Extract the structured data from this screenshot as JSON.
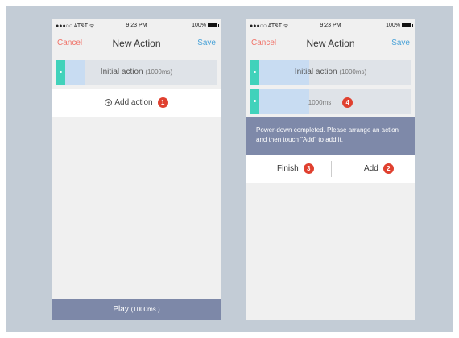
{
  "left_screen": {
    "status": {
      "carrier": "●●●○○ AT&T ᯤ",
      "time": "9:23 PM",
      "battery": "100%"
    },
    "nav": {
      "cancel": "Cancel",
      "title": "New Action",
      "save": "Save"
    },
    "rows": [
      {
        "label": "Initial action",
        "duration": "(1000ms)"
      }
    ],
    "add_action": {
      "label": "Add action",
      "badge": "1"
    },
    "play": {
      "label": "Play",
      "duration": "(1000ms )"
    }
  },
  "right_screen": {
    "status": {
      "carrier": "●●●○○ AT&T ᯤ",
      "time": "9:23 PM",
      "battery": "100%"
    },
    "nav": {
      "cancel": "Cancel",
      "title": "New Action",
      "save": "Save"
    },
    "rows": [
      {
        "label": "Initial action",
        "duration": "(1000ms)"
      },
      {
        "label": "1000ms",
        "badge": "4"
      }
    ],
    "toast": "Power-down completed. Please arrange an action and then touch \"Add\" to add it.",
    "finish": {
      "label": "Finish",
      "badge": "3"
    },
    "add": {
      "label": "Add",
      "badge": "2"
    }
  },
  "colors": {
    "backdrop": "#c3ccd6",
    "accent_teal": "#41d2bb",
    "bar_fill": "#c8dcf2",
    "cancel_red": "#f0746a",
    "save_blue": "#4ba3d8",
    "badge_red": "#e0402f",
    "toast_bg": "#7e89a9"
  },
  "icons": {
    "add": "plus-circle-icon",
    "battery": "battery-icon",
    "wifi": "wifi-icon"
  }
}
